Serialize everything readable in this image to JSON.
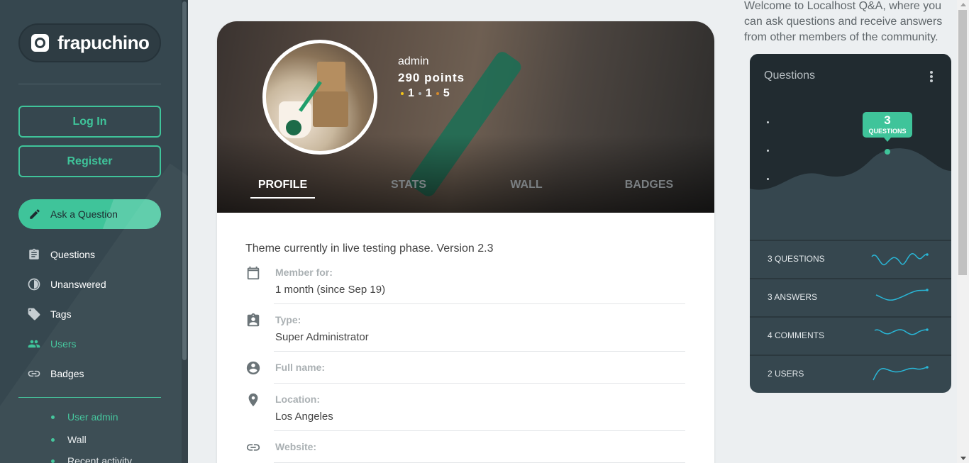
{
  "brand": {
    "name": "frapuchino"
  },
  "sidebar": {
    "login_label": "Log In",
    "register_label": "Register",
    "ask_label": "Ask a Question",
    "nav": [
      {
        "label": "Questions",
        "icon": "clipboard-icon"
      },
      {
        "label": "Unanswered",
        "icon": "half-circle-icon"
      },
      {
        "label": "Tags",
        "icon": "tag-icon"
      },
      {
        "label": "Users",
        "icon": "users-icon",
        "active": true
      },
      {
        "label": "Badges",
        "icon": "link-icon"
      }
    ],
    "sub_nav": [
      {
        "label": "User admin",
        "active": true
      },
      {
        "label": "Wall"
      },
      {
        "label": "Recent activity"
      }
    ]
  },
  "profile": {
    "username": "admin",
    "points": "290 points",
    "badges": {
      "gold": "1",
      "silver": "1",
      "bronze": "5"
    },
    "tabs": [
      "PROFILE",
      "STATS",
      "WALL",
      "BADGES"
    ],
    "active_tab": "PROFILE",
    "theme_note": "Theme currently in live testing phase. Version 2.3",
    "fields": [
      {
        "label": "Member for:",
        "value": "1 month (since Sep 19)",
        "icon": "calendar-icon"
      },
      {
        "label": "Type:",
        "value": "Super Administrator",
        "icon": "badge-icon"
      },
      {
        "label": "Full name:",
        "value": "",
        "icon": "account-circle-icon"
      },
      {
        "label": "Location:",
        "value": "Los Angeles",
        "icon": "location-pin-icon"
      },
      {
        "label": "Website:",
        "value": "",
        "icon": "link-icon"
      }
    ]
  },
  "right": {
    "welcome": "Welcome to Localhost Q&A, where you can ask questions and receive answers from other members of the community.",
    "panel_title": "Questions",
    "tooltip_value": "3",
    "tooltip_label": "QUESTIONS",
    "stats": [
      {
        "label": "3 QUESTIONS"
      },
      {
        "label": "3 ANSWERS"
      },
      {
        "label": "4 COMMENTS"
      },
      {
        "label": "2 USERS"
      }
    ]
  },
  "colors": {
    "accent": "#3fc49a",
    "sidebar": "#36474f",
    "panel_dark": "#212b30",
    "sparkline": "#29b6d6",
    "gold": "#f5c518",
    "silver": "#b0b6b9",
    "bronze": "#d58a2c"
  }
}
